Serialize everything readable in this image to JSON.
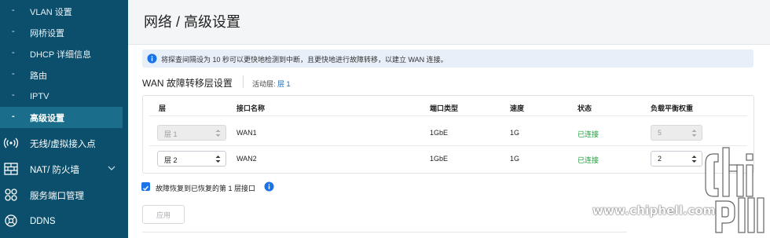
{
  "sidebar": {
    "sub_items": [
      {
        "label": "VLAN 设置",
        "active": false
      },
      {
        "label": "网桥设置",
        "active": false
      },
      {
        "label": "DHCP 详细信息",
        "active": false
      },
      {
        "label": "路由",
        "active": false
      },
      {
        "label": "IPTV",
        "active": false
      },
      {
        "label": "高级设置",
        "active": true
      }
    ],
    "main_items": [
      {
        "label": "无线/虚拟接入点",
        "icon": "wireless-icon"
      },
      {
        "label": "NAT/ 防火墙",
        "icon": "firewall-icon"
      },
      {
        "label": "服务端口管理",
        "icon": "service-port-icon"
      },
      {
        "label": "DDNS",
        "icon": "ddns-icon"
      }
    ]
  },
  "header": {
    "title": "网络 / 高级设置"
  },
  "info": {
    "text": "将探查间隔设为 10 秒可以更快地检测到中断，且更快地进行故障转移，以建立 WAN 连接。"
  },
  "section": {
    "title": "WAN 故障转移层设置",
    "active_label": "活动层:",
    "active_value": "层 1"
  },
  "table": {
    "headers": [
      "层",
      "接口名称",
      "端口类型",
      "速度",
      "状态",
      "负载平衡权重"
    ],
    "rows": [
      {
        "tier": "层 1",
        "tier_disabled": true,
        "name": "WAN1",
        "port_type": "1GbE",
        "speed": "1G",
        "status": "已连接",
        "weight": "5",
        "weight_disabled": true
      },
      {
        "tier": "层 2",
        "tier_disabled": false,
        "name": "WAN2",
        "port_type": "1GbE",
        "speed": "1G",
        "status": "已连接",
        "weight": "2",
        "weight_disabled": false
      }
    ]
  },
  "failback": {
    "label": "故障恢复到已恢复的第 1 层接口",
    "checked": true
  },
  "buttons": {
    "apply": "应用"
  },
  "watermark": {
    "text": "www.chiphell.com"
  },
  "colors": {
    "sidebar": "#0b4f6c",
    "accent": "#1a73e8",
    "connected": "#1f9e3c"
  }
}
